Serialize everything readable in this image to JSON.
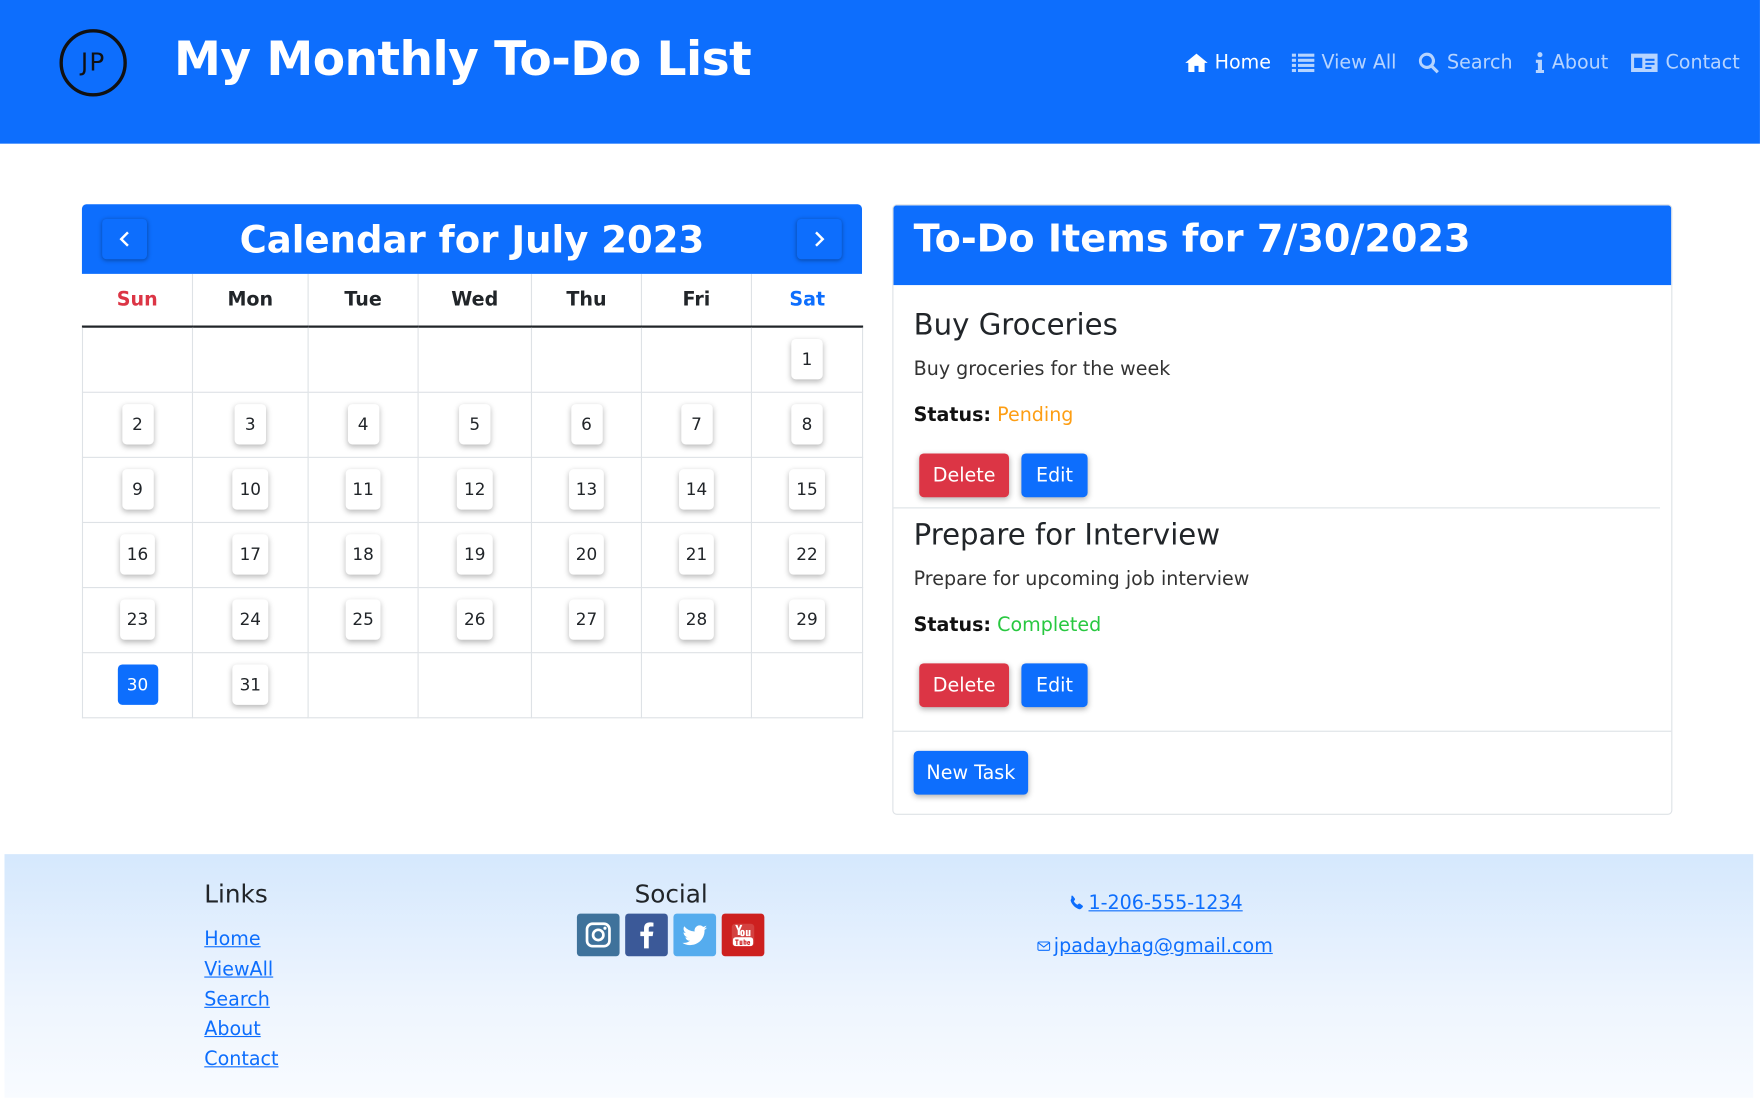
{
  "header": {
    "logo_text": "JP",
    "title": "My Monthly To-Do List",
    "nav": [
      {
        "label": "Home",
        "icon": "home-icon",
        "active": true
      },
      {
        "label": "View All",
        "icon": "list-icon"
      },
      {
        "label": "Search",
        "icon": "search-icon"
      },
      {
        "label": "About",
        "icon": "info-icon"
      },
      {
        "label": "Contact",
        "icon": "contact-card-icon"
      }
    ]
  },
  "calendar": {
    "title": "Calendar for July 2023",
    "weekdays": [
      "Sun",
      "Mon",
      "Tue",
      "Wed",
      "Thu",
      "Fri",
      "Sat"
    ],
    "weeks": [
      [
        "",
        "",
        "",
        "",
        "",
        "",
        "1"
      ],
      [
        "2",
        "3",
        "4",
        "5",
        "6",
        "7",
        "8"
      ],
      [
        "9",
        "10",
        "11",
        "12",
        "13",
        "14",
        "15"
      ],
      [
        "16",
        "17",
        "18",
        "19",
        "20",
        "21",
        "22"
      ],
      [
        "23",
        "24",
        "25",
        "26",
        "27",
        "28",
        "29"
      ],
      [
        "30",
        "31",
        "",
        "",
        "",
        "",
        ""
      ]
    ],
    "selected_day": "30",
    "colors": {
      "sunday": "#dc3545",
      "saturday": "#0d6efd",
      "accent": "#0d6efd"
    }
  },
  "todo": {
    "title": "To-Do Items for 7/30/2023",
    "status_label": "Status:",
    "tasks": [
      {
        "title": "Buy Groceries",
        "description": "Buy groceries for the week",
        "status": "Pending",
        "status_color": "#fd9e14"
      },
      {
        "title": "Prepare for Interview",
        "description": "Prepare for upcoming job interview",
        "status": "Completed",
        "status_color": "#28c840"
      }
    ],
    "delete_label": "Delete",
    "edit_label": "Edit",
    "new_task_label": "New Task"
  },
  "footer": {
    "links_heading": "Links",
    "links": [
      "Home",
      "ViewAll",
      "Search",
      "About",
      "Contact"
    ],
    "social_heading": "Social",
    "social": [
      {
        "name": "instagram-icon",
        "color": "#3f729b"
      },
      {
        "name": "facebook-icon",
        "color": "#3b5998"
      },
      {
        "name": "twitter-icon",
        "color": "#55acee"
      },
      {
        "name": "youtube-icon",
        "color": "#cd201f"
      }
    ],
    "phone": " 1-206-555-1234",
    "email": "jpadayhag@gmail.com"
  }
}
